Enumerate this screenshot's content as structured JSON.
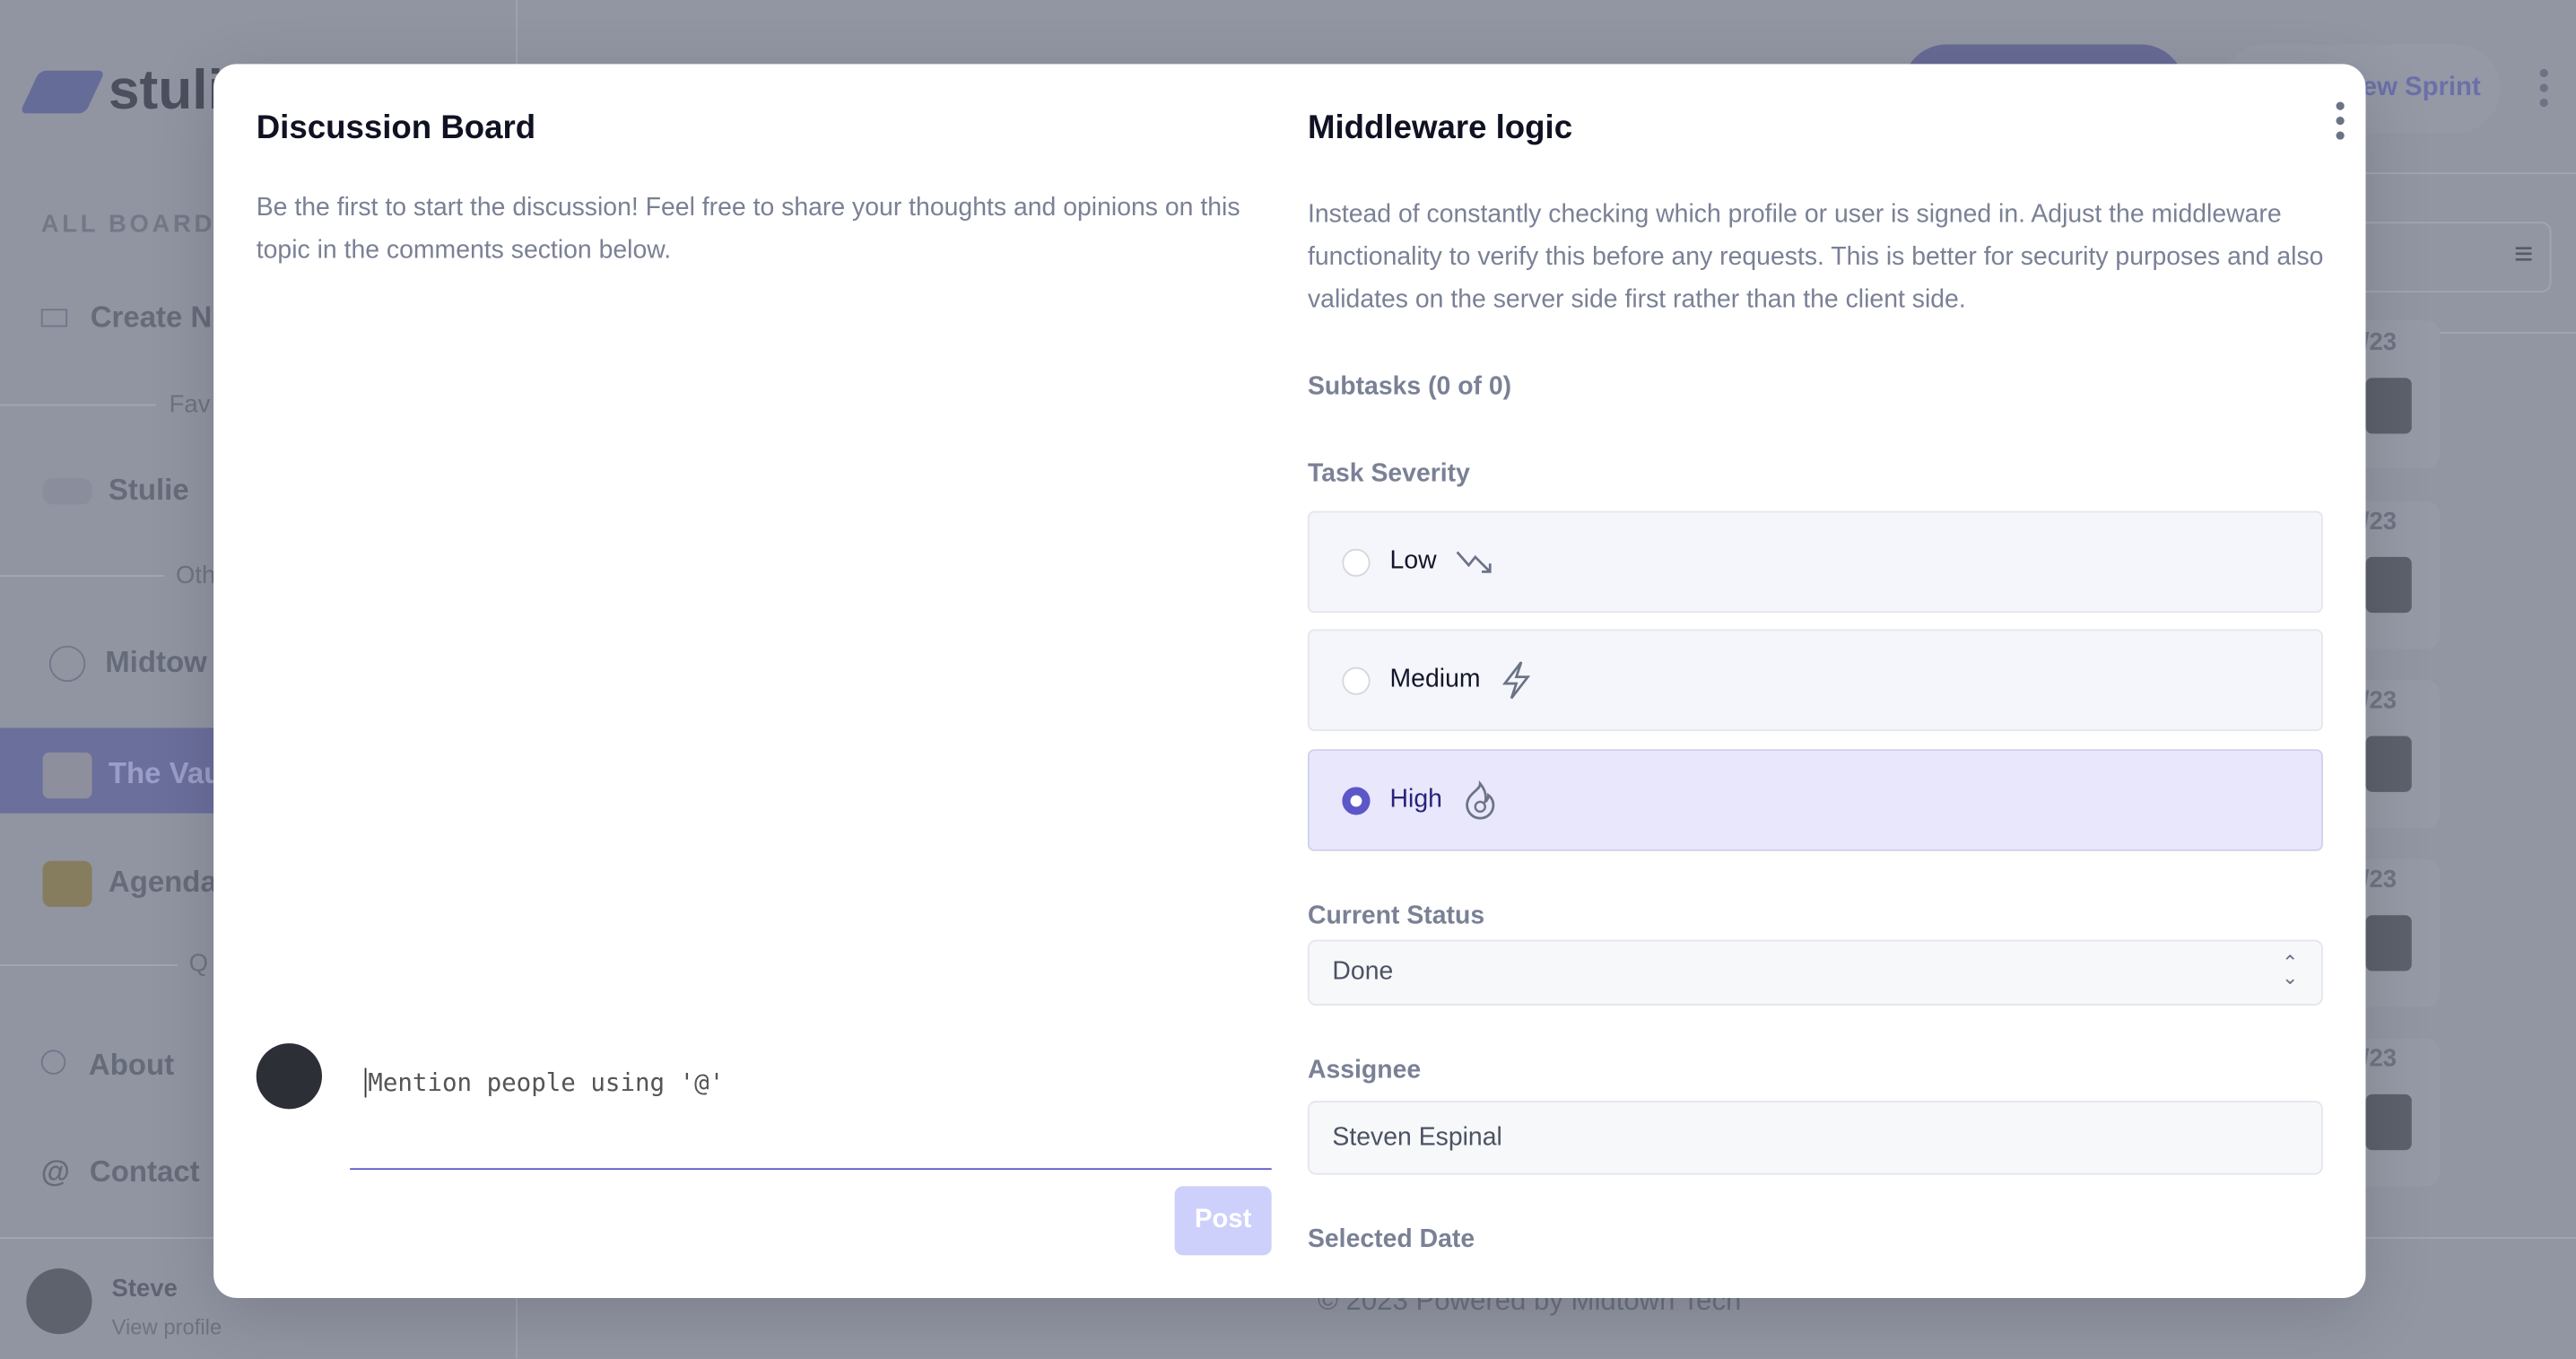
{
  "sidebar": {
    "logo": "stuli",
    "section": "ALL BOARDS",
    "create": "Create N",
    "fav": "Fav",
    "stulie": "Stulie",
    "other": "Oth",
    "midtown": "Midtow",
    "vault": "The Vau",
    "agenda": "Agenda",
    "q": "Q",
    "about": "About",
    "contact": "Contact",
    "user": "Steve",
    "view_profile": "View profile"
  },
  "header": {
    "new_sprint": "ew Sprint"
  },
  "cards": {
    "dates": [
      "/23",
      "/23",
      "/23",
      "/23",
      "/23"
    ]
  },
  "footer": "© 2023 Powered by Midtown Tech",
  "modal": {
    "discussion": {
      "title": "Discussion Board",
      "empty": "Be the first to start the discussion! Feel free to share your thoughts and opinions on this topic in the comments section below.",
      "placeholder": "Mention people using '@'",
      "post": "Post"
    },
    "task": {
      "title": "Middleware logic",
      "description": "Instead of constantly checking which profile or user is signed in. Adjust the middleware functionality to verify this before any requests. This is better for security purposes and also validates on the server side first rather than the client side.",
      "subtasks": "Subtasks (0 of 0)",
      "severity_label": "Task Severity",
      "severity": [
        {
          "label": "Low",
          "icon": "trend-down-icon",
          "selected": false
        },
        {
          "label": "Medium",
          "icon": "lightning-icon",
          "selected": false
        },
        {
          "label": "High",
          "icon": "flame-icon",
          "selected": true
        }
      ],
      "status_label": "Current Status",
      "status": "Done",
      "assignee_label": "Assignee",
      "assignee": "Steven Espinal",
      "date_label": "Selected Date"
    }
  },
  "colors": {
    "accent": "#5b57c9",
    "overlay": "#9296a3",
    "selected_option": "#e8e7fc"
  }
}
